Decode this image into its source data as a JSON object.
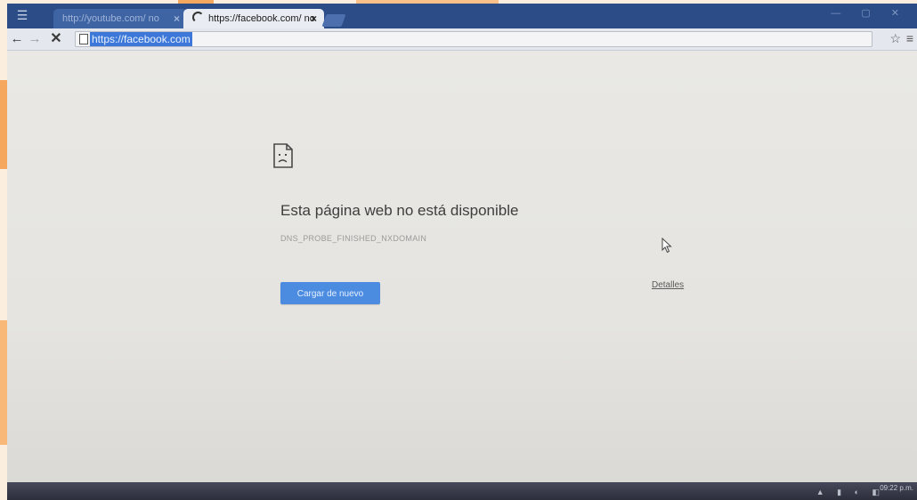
{
  "browser": {
    "tabs": [
      {
        "title": "http://youtube.com/ no",
        "active": false
      },
      {
        "title": "https://facebook.com/ no",
        "active": true
      }
    ],
    "close_glyph": "×",
    "address_bar": {
      "url": "https://facebook.com"
    },
    "icons": {
      "back": "←",
      "forward": "→",
      "stop": "✕",
      "bookmark_star": "☆",
      "menu": "≡",
      "app": "☰"
    }
  },
  "error_page": {
    "title": "Esta página web no está disponible",
    "error_code": "DNS_PROBE_FINISHED_NXDOMAIN",
    "reload_button_label": "Cargar de nuevo",
    "details_link_label": "Detalles"
  },
  "taskbar": {
    "clock_time": "09:22 p.m."
  },
  "colors": {
    "tabstrip": "#2b4c86",
    "url_highlight": "#3d78d8",
    "reload_button": "#4c8ce0",
    "page_background": "#e9e8e4"
  }
}
